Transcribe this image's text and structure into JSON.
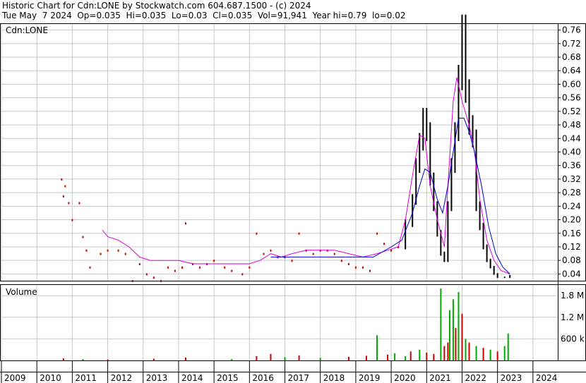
{
  "header": {
    "line1": "Historic Chart for Cdn:LONE by Stockwatch.com 604.687.1500 - (c) 2024",
    "line2": "Tue May  7 2024  Op=0.035  Hi=0.035  Lo=0.03  Cl=0.035  Vol=91,941  Year hi=0.79  lo=0.02"
  },
  "panels": {
    "price_label": "Cdn:LONE",
    "volume_label": "Volume"
  },
  "colors": {
    "price_bar": "#000000",
    "short_ma": "#dd00dd",
    "long_ma": "#0000cc",
    "gap_marker": "#cc0000",
    "volume_up": "#00aa00",
    "volume_down": "#cc0000",
    "grid": "#c8c8c8"
  },
  "chart_data": [
    {
      "type": "line",
      "title": "",
      "x_axis_ticks": [
        "2009",
        "2010",
        "2011",
        "2012",
        "2013",
        "2014",
        "2015",
        "2016",
        "2017",
        "2018",
        "2019",
        "2020",
        "2021",
        "2022",
        "2023",
        "2024"
      ],
      "y_ticks": [
        "0.04",
        "0.08",
        "0.12",
        "0.16",
        "0.20",
        "0.24",
        "0.28",
        "0.32",
        "0.36",
        "0.40",
        "0.44",
        "0.48",
        "0.52",
        "0.56",
        "0.60",
        "0.64",
        "0.68",
        "0.72",
        "0.76"
      ],
      "ylim": [
        0.02,
        0.78
      ],
      "series": [
        {
          "name": "",
          "kind": "price",
          "points": [
            [
              2010.7,
              0.32
            ],
            [
              2010.75,
              0.27
            ],
            [
              2010.8,
              0.3
            ],
            [
              2010.9,
              0.25
            ],
            [
              2011.0,
              0.2
            ],
            [
              2011.2,
              0.25
            ],
            [
              2011.3,
              0.15
            ],
            [
              2011.4,
              0.11
            ],
            [
              2011.5,
              0.06
            ],
            [
              2011.8,
              0.1
            ],
            [
              2012.0,
              0.11
            ],
            [
              2012.3,
              0.11
            ],
            [
              2012.5,
              0.1
            ],
            [
              2012.7,
              0.02
            ],
            [
              2012.9,
              0.07
            ],
            [
              2013.1,
              0.04
            ],
            [
              2013.3,
              0.03
            ],
            [
              2013.5,
              0.02
            ],
            [
              2013.7,
              0.06
            ],
            [
              2013.9,
              0.05
            ],
            [
              2014.1,
              0.06
            ],
            [
              2014.2,
              0.19
            ],
            [
              2014.4,
              0.07
            ],
            [
              2014.6,
              0.06
            ],
            [
              2014.8,
              0.07
            ],
            [
              2015.0,
              0.08
            ],
            [
              2015.3,
              0.06
            ],
            [
              2015.5,
              0.05
            ],
            [
              2015.8,
              0.04
            ],
            [
              2016.0,
              0.06
            ],
            [
              2016.2,
              0.16
            ],
            [
              2016.4,
              0.1
            ],
            [
              2016.6,
              0.11
            ],
            [
              2016.8,
              0.09
            ],
            [
              2017.0,
              0.09
            ],
            [
              2017.2,
              0.08
            ],
            [
              2017.4,
              0.16
            ],
            [
              2017.6,
              0.11
            ],
            [
              2017.8,
              0.1
            ],
            [
              2018.0,
              0.11
            ],
            [
              2018.2,
              0.11
            ],
            [
              2018.4,
              0.1
            ],
            [
              2018.6,
              0.08
            ],
            [
              2018.8,
              0.07
            ],
            [
              2019.0,
              0.06
            ],
            [
              2019.2,
              0.06
            ],
            [
              2019.4,
              0.05
            ],
            [
              2019.6,
              0.16
            ],
            [
              2019.8,
              0.13
            ],
            [
              2020.0,
              0.11
            ],
            [
              2020.2,
              0.12
            ],
            [
              2020.4,
              0.19
            ],
            [
              2020.6,
              0.26
            ],
            [
              2020.7,
              0.36
            ],
            [
              2020.8,
              0.43
            ],
            [
              2020.9,
              0.5
            ],
            [
              2021.0,
              0.46
            ],
            [
              2021.1,
              0.32
            ],
            [
              2021.2,
              0.24
            ],
            [
              2021.3,
              0.16
            ],
            [
              2021.4,
              0.1
            ],
            [
              2021.5,
              0.08
            ],
            [
              2021.6,
              0.24
            ],
            [
              2021.7,
              0.36
            ],
            [
              2021.8,
              0.46
            ],
            [
              2021.9,
              0.62
            ],
            [
              2022.0,
              0.76
            ],
            [
              2022.1,
              0.58
            ],
            [
              2022.2,
              0.48
            ],
            [
              2022.3,
              0.44
            ],
            [
              2022.4,
              0.24
            ],
            [
              2022.5,
              0.18
            ],
            [
              2022.6,
              0.12
            ],
            [
              2022.7,
              0.08
            ],
            [
              2022.8,
              0.06
            ],
            [
              2022.9,
              0.04
            ],
            [
              2023.0,
              0.03
            ],
            [
              2023.2,
              0.03
            ],
            [
              2023.35,
              0.035
            ]
          ]
        },
        {
          "name": "",
          "kind": "short_ma",
          "points": [
            [
              2011.85,
              0.17
            ],
            [
              2012.0,
              0.15
            ],
            [
              2012.3,
              0.14
            ],
            [
              2012.6,
              0.12
            ],
            [
              2012.9,
              0.09
            ],
            [
              2013.2,
              0.08
            ],
            [
              2013.6,
              0.08
            ],
            [
              2014.0,
              0.08
            ],
            [
              2014.4,
              0.07
            ],
            [
              2014.8,
              0.07
            ],
            [
              2015.2,
              0.07
            ],
            [
              2015.6,
              0.07
            ],
            [
              2016.0,
              0.07
            ],
            [
              2016.3,
              0.08
            ],
            [
              2016.6,
              0.1
            ],
            [
              2016.9,
              0.09
            ],
            [
              2017.2,
              0.1
            ],
            [
              2017.6,
              0.11
            ],
            [
              2018.0,
              0.11
            ],
            [
              2018.4,
              0.11
            ],
            [
              2018.8,
              0.1
            ],
            [
              2019.2,
              0.09
            ],
            [
              2019.6,
              0.1
            ],
            [
              2019.9,
              0.11
            ],
            [
              2020.2,
              0.12
            ],
            [
              2020.4,
              0.2
            ],
            [
              2020.6,
              0.33
            ],
            [
              2020.8,
              0.45
            ],
            [
              2020.95,
              0.44
            ],
            [
              2021.1,
              0.3
            ],
            [
              2021.3,
              0.2
            ],
            [
              2021.5,
              0.12
            ],
            [
              2021.6,
              0.3
            ],
            [
              2021.75,
              0.55
            ],
            [
              2021.85,
              0.62
            ],
            [
              2022.0,
              0.55
            ],
            [
              2022.2,
              0.48
            ],
            [
              2022.35,
              0.4
            ],
            [
              2022.5,
              0.26
            ],
            [
              2022.7,
              0.14
            ],
            [
              2022.9,
              0.08
            ],
            [
              2023.1,
              0.05
            ],
            [
              2023.35,
              0.04
            ]
          ]
        },
        {
          "name": "",
          "kind": "long_ma",
          "points": [
            [
              2016.6,
              0.09
            ],
            [
              2017.0,
              0.09
            ],
            [
              2017.4,
              0.09
            ],
            [
              2018.0,
              0.09
            ],
            [
              2018.5,
              0.09
            ],
            [
              2019.0,
              0.09
            ],
            [
              2019.5,
              0.09
            ],
            [
              2020.0,
              0.12
            ],
            [
              2020.3,
              0.14
            ],
            [
              2020.6,
              0.22
            ],
            [
              2020.8,
              0.3
            ],
            [
              2020.95,
              0.35
            ],
            [
              2021.1,
              0.34
            ],
            [
              2021.3,
              0.26
            ],
            [
              2021.45,
              0.22
            ],
            [
              2021.6,
              0.3
            ],
            [
              2021.75,
              0.4
            ],
            [
              2021.9,
              0.5
            ],
            [
              2022.05,
              0.5
            ],
            [
              2022.2,
              0.46
            ],
            [
              2022.35,
              0.4
            ],
            [
              2022.55,
              0.3
            ],
            [
              2022.75,
              0.18
            ],
            [
              2022.95,
              0.1
            ],
            [
              2023.15,
              0.06
            ],
            [
              2023.35,
              0.04
            ]
          ]
        }
      ]
    },
    {
      "type": "bar",
      "title": "",
      "y_ticks": [
        "600 k",
        "1.2 M",
        "1.8 M"
      ],
      "ylim": [
        0,
        2000000
      ],
      "bars": [
        [
          2010.75,
          60000,
          "down"
        ],
        [
          2011.3,
          40000,
          "up"
        ],
        [
          2012.0,
          30000,
          "down"
        ],
        [
          2013.3,
          50000,
          "down"
        ],
        [
          2014.2,
          80000,
          "down"
        ],
        [
          2015.5,
          40000,
          "up"
        ],
        [
          2016.2,
          120000,
          "down"
        ],
        [
          2016.6,
          180000,
          "down"
        ],
        [
          2017.0,
          90000,
          "up"
        ],
        [
          2017.4,
          140000,
          "down"
        ],
        [
          2018.0,
          70000,
          "up"
        ],
        [
          2018.8,
          100000,
          "down"
        ],
        [
          2019.3,
          130000,
          "down"
        ],
        [
          2019.6,
          700000,
          "up"
        ],
        [
          2019.9,
          160000,
          "down"
        ],
        [
          2020.1,
          200000,
          "up"
        ],
        [
          2020.4,
          120000,
          "up"
        ],
        [
          2020.55,
          250000,
          "down"
        ],
        [
          2020.8,
          300000,
          "up"
        ],
        [
          2021.0,
          220000,
          "down"
        ],
        [
          2021.2,
          180000,
          "down"
        ],
        [
          2021.4,
          2000000,
          "up"
        ],
        [
          2021.5,
          400000,
          "down"
        ],
        [
          2021.6,
          500000,
          "down"
        ],
        [
          2021.65,
          1400000,
          "up"
        ],
        [
          2021.75,
          1700000,
          "up"
        ],
        [
          2021.82,
          900000,
          "down"
        ],
        [
          2021.9,
          1900000,
          "up"
        ],
        [
          2022.0,
          1300000,
          "down"
        ],
        [
          2022.1,
          600000,
          "up"
        ],
        [
          2022.2,
          500000,
          "down"
        ],
        [
          2022.4,
          400000,
          "up"
        ],
        [
          2022.6,
          350000,
          "down"
        ],
        [
          2022.8,
          300000,
          "up"
        ],
        [
          2023.0,
          250000,
          "down"
        ],
        [
          2023.2,
          400000,
          "up"
        ],
        [
          2023.3,
          750000,
          "up"
        ]
      ]
    }
  ]
}
